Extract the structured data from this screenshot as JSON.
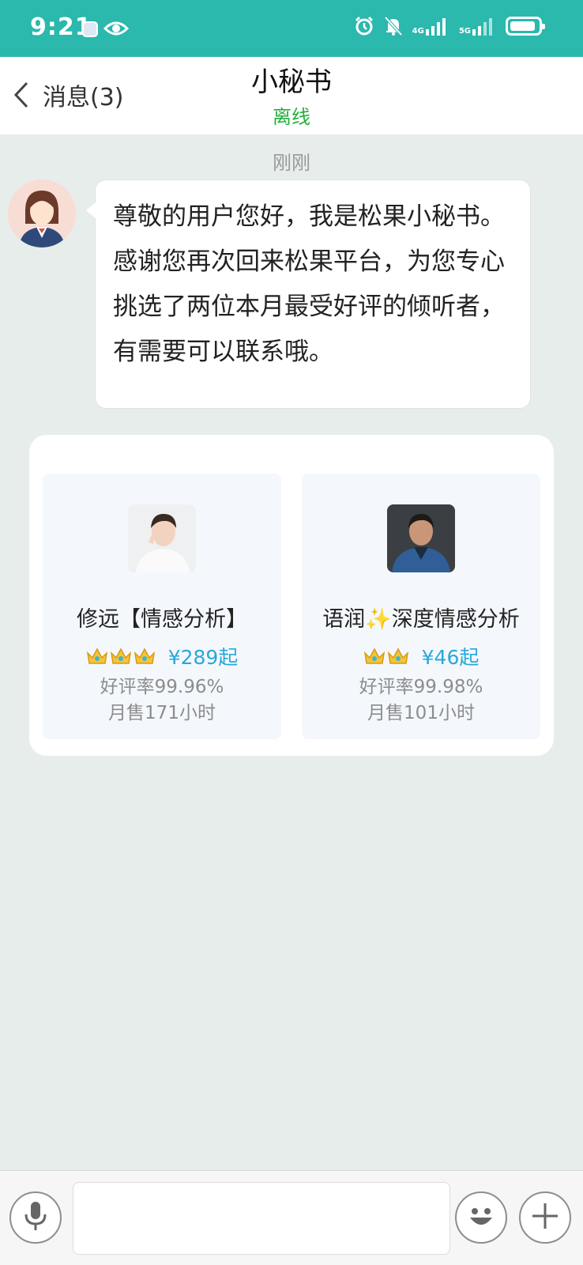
{
  "status_bar": {
    "time": "9:21",
    "network_1": "4G",
    "network_2": "5G",
    "battery_level": 0.9,
    "icons": [
      "app-icon",
      "eye-icon",
      "alarm-icon",
      "mute-bell-icon",
      "signal-4g-icon",
      "signal-5g-icon",
      "battery-icon"
    ]
  },
  "header": {
    "back_label": "消息(3)",
    "title": "小秘书",
    "status": "离线"
  },
  "chat": {
    "timestamp": "刚刚",
    "message": "尊敬的用户您好，我是松果小秘书。感谢您再次回来松果平台，为您专心挑选了两位本月最受好评的倾听者，有需要可以联系哦。"
  },
  "recommendations": [
    {
      "name": "修远【情感分析】",
      "crowns": 3,
      "price": "¥289起",
      "rating": "好评率99.96%",
      "sales": "月售171小时"
    },
    {
      "name": "语润✨深度情感分析",
      "crowns": 2,
      "price": "¥46起",
      "rating": "好评率99.98%",
      "sales": "月售101小时"
    }
  ],
  "input_bar": {
    "icons": [
      "microphone-icon",
      "emoji-icon",
      "plus-icon"
    ]
  },
  "colors": {
    "status_bar": "#2bb8ad",
    "online_status": "#27ae3f",
    "price": "#29a8d8",
    "background": "#e7edeb"
  }
}
